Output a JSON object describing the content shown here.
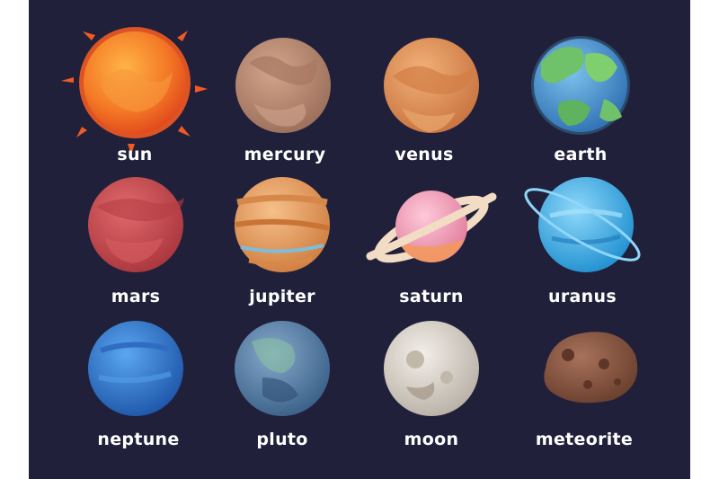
{
  "bodies": [
    {
      "id": "sun",
      "label": "sun"
    },
    {
      "id": "mercury",
      "label": "mercury"
    },
    {
      "id": "venus",
      "label": "venus"
    },
    {
      "id": "earth",
      "label": "earth"
    },
    {
      "id": "mars",
      "label": "mars"
    },
    {
      "id": "jupiter",
      "label": "jupiter"
    },
    {
      "id": "saturn",
      "label": "saturn"
    },
    {
      "id": "uranus",
      "label": "uranus"
    },
    {
      "id": "neptune",
      "label": "neptune"
    },
    {
      "id": "pluto",
      "label": "pluto"
    },
    {
      "id": "moon",
      "label": "moon"
    },
    {
      "id": "meteorite",
      "label": "meteorite"
    }
  ],
  "colors": {
    "background": "#20203a",
    "sun": "#f15a22",
    "mercury": "#b98a73",
    "venus": "#e0935a",
    "earth": "#4f9ad6",
    "mars": "#c8484c",
    "jupiter": "#e6a36a",
    "saturn": "#f0a4bc",
    "uranus": "#3fb0e8",
    "neptune": "#2f7fd4",
    "pluto": "#4f7aa3",
    "moon": "#d8d2c8",
    "meteorite": "#8a5a45"
  }
}
